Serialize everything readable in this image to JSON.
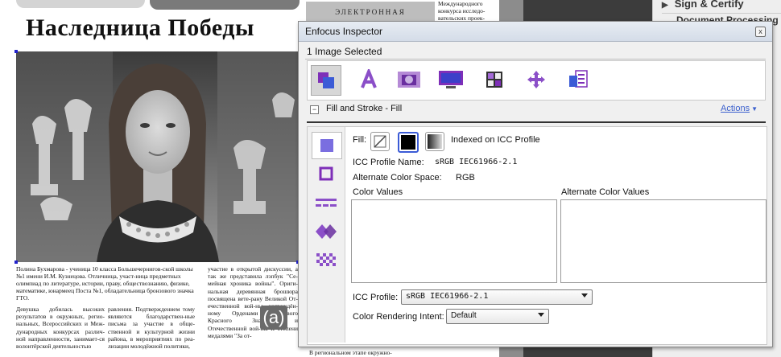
{
  "newspaper": {
    "headline": "Наследница Победы",
    "caption": "Полина Бухмарова - ученица 10 класса Большечернигов-ской школы №1 имени И.М. Кузнецова. Отличница, участ-ница предметных олимпиад по литературе, истории, праву, обществознанию, физике, математике, юнармеец Поста №1, обладательница бронзового значка ГТО.",
    "col1": "Девушка добилась высоких результатов в окружных, регио-нальных, Всероссийских и Меж-дународных конкурсах различ-ной направленности, занимает-ся волонтёрской деятельностью",
    "col2": "равления. Подтверждением тому являются благодарствен-ные письма за участие в обще-ственной и культурной жизни района, в мероприятиях по реа-лизации молодёжной политики,",
    "col3": "участие в открытой дискуссии, а так же представила лэпбук \"Се-мейная хроника войны\". Ориги-нальная деревянная брошюра посвящена вете-рану Великой От-ечественной вой-ны, награждён-ному Орденами Тру-дового Красного Знамени и Отечественной вой-ны II степени медалями \"За от-",
    "rights_icon": "(a)",
    "strip_banner": "ЭЛЕКТРОННАЯ",
    "strip_text": "Международного конкурса исследо-вательских проек-",
    "strip_bottom": "В региональном этапе окружно-"
  },
  "sidebar": {
    "sign_certify": "Sign & Certify",
    "document_processing": "Document Processing"
  },
  "inspector": {
    "title": "Enfocus Inspector",
    "close_glyph": "x",
    "selection_status": "1 Image Selected",
    "toolbar_icons": [
      "image-icon",
      "text-icon",
      "camera-icon",
      "monitor-icon",
      "color-swatches-icon",
      "move-arrows-icon",
      "info-icon"
    ],
    "section_title": "Fill and Stroke - Fill",
    "collapse_glyph": "−",
    "actions_label": "Actions",
    "side_icons": [
      "fill-square-icon",
      "stroke-square-icon",
      "dashed-lines-icon",
      "transparency-diamond-icon",
      "checker-pattern-icon"
    ],
    "fill_label": "Fill:",
    "fill_mode": "Indexed on ICC Profile",
    "icc_profile_name_label": "ICC Profile Name:",
    "icc_profile_name_value": "sRGB IEC61966-2.1",
    "alt_space_label": "Alternate Color Space:",
    "alt_space_value": "RGB",
    "color_values_label": "Color Values",
    "alt_color_values_label": "Alternate Color Values",
    "icc_profile_label": "ICC Profile:",
    "icc_profile_value": "sRGB IEC61966-2.1",
    "rendering_intent_label": "Color Rendering Intent:",
    "rendering_intent_value": "Default",
    "accent_color": "#8b4fc8",
    "link_color": "#3a5fcd"
  }
}
